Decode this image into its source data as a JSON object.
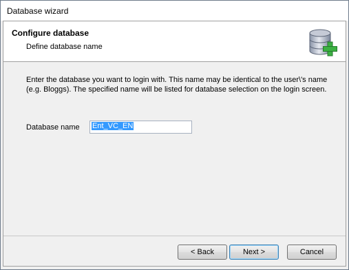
{
  "window": {
    "title": "Database wizard"
  },
  "header": {
    "title": "Configure database",
    "subtitle": "Define database name",
    "icon": "database-add-icon"
  },
  "content": {
    "description": "Enter the database you want to login with. This name may be identical to  the user\\'s name\n(e.g. Bloggs). The specified name will be listed for database selection on the login screen.",
    "database_name_label": "Database name",
    "database_name_value": "Ent_VC_EN"
  },
  "buttons": {
    "back": "< Back",
    "next": "Next >",
    "cancel": "Cancel"
  },
  "colors": {
    "selection": "#3399ff",
    "plus_icon": "#3cb043"
  }
}
